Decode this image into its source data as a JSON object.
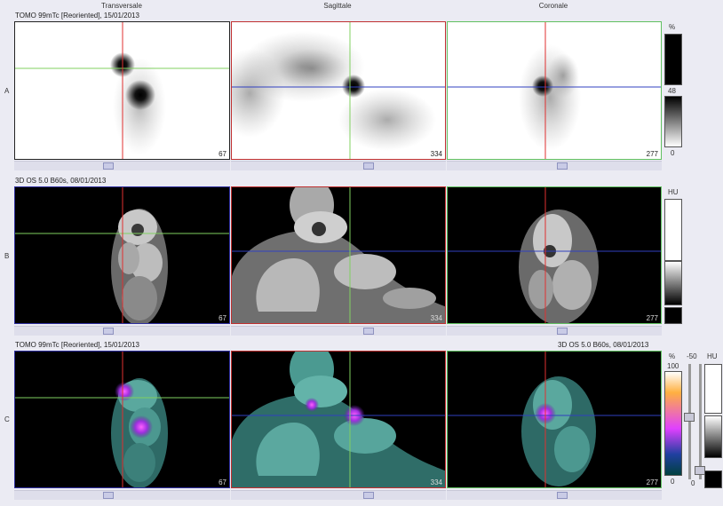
{
  "columns": {
    "transversale": "Transversale",
    "sagittale": "Sagittale",
    "coronale": "Coronale"
  },
  "rows": {
    "a": {
      "letter": "A",
      "title": "TOMO 99mTc [Reoriented], 15/01/2013"
    },
    "b": {
      "letter": "B",
      "title": "3D  OS  5.0  B60s, 08/01/2013"
    },
    "c": {
      "letter": "C",
      "title": "TOMO 99mTc [Reoriented], 15/01/2013",
      "title_right": "3D  OS  5.0  B60s, 08/01/2013"
    }
  },
  "slices": {
    "transversale": "67",
    "sagittale": "334",
    "coronale": "277"
  },
  "colorbar_a": {
    "unit": "%",
    "mid": "48",
    "min": "0"
  },
  "colorbar_b": {
    "unit": "HU"
  },
  "colorbar_c": {
    "unit": "%",
    "max": "100",
    "min": "0",
    "ct_unit": "HU",
    "ct_value": "-50",
    "ct_min": "0"
  },
  "colors": {
    "red_frame": "#c03030",
    "green_frame": "#60c060",
    "blue_frame": "#3030a0",
    "crosshair_red": "#e03030",
    "crosshair_green": "#80d060",
    "crosshair_blue": "#3040c0",
    "hotspot": "#c040ff"
  }
}
